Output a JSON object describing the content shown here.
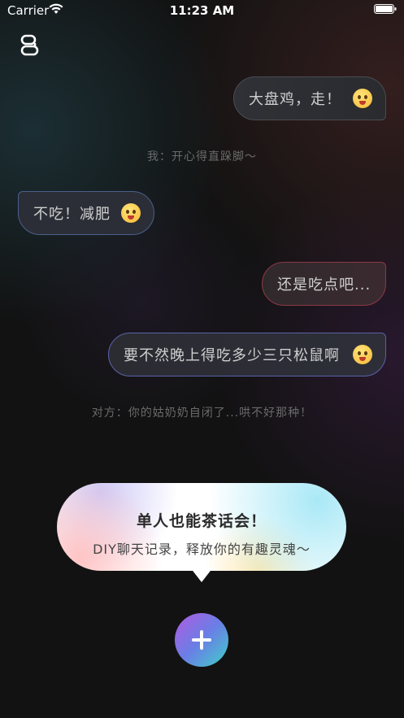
{
  "status_bar": {
    "carrier": "Carrier",
    "time": "11:23 AM"
  },
  "chat": {
    "messages": [
      {
        "text": "大盘鸡，走！",
        "side": "right",
        "emoji": "crazy-face-emoji"
      },
      {
        "text": "不吃！减肥",
        "side": "left",
        "emoji": "fearful-face-emoji"
      },
      {
        "text": "还是吃点吧...",
        "side": "right",
        "emoji": ""
      },
      {
        "text": "要不然晚上得吃多少三只松鼠啊",
        "side": "right",
        "emoji": "saluting-face-emoji"
      }
    ],
    "captions": [
      "我：开心得直跺脚～",
      "对方：你的姑奶奶自闭了...哄不好那种！"
    ]
  },
  "promo": {
    "title": "单人也能茶话会！",
    "subtitle": "DIY聊天记录，释放你的有趣灵魂～"
  },
  "icons": {
    "logo": "app-logo-icon",
    "add": "plus-icon"
  }
}
